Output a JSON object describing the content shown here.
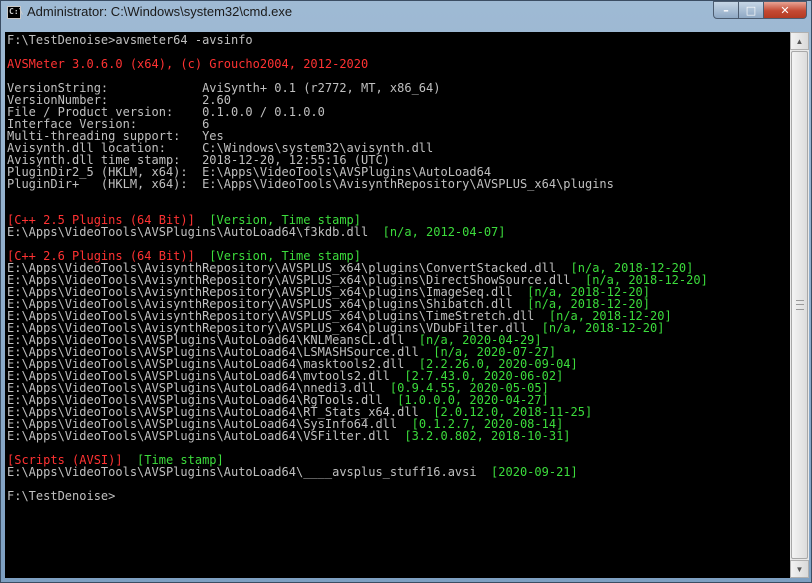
{
  "window": {
    "icon_label": "C:\\",
    "title": "Administrator: C:\\Windows\\system32\\cmd.exe",
    "minimize_glyph": "–",
    "maximize_glyph": "□",
    "close_glyph": "✕"
  },
  "colors": {
    "red": "#ff3232",
    "green": "#3cdc3c",
    "gray": "#c0c0c0",
    "console_bg": "#000000"
  },
  "console": {
    "lines": [
      [
        {
          "t": "F:\\TestDenoise>avsmeter64 -avsinfo",
          "c": "gray"
        }
      ],
      [],
      [
        {
          "t": "AVSMeter 3.0.6.0 (x64), (c) Groucho2004, 2012-2020",
          "c": "red"
        }
      ],
      [],
      [
        {
          "t": "VersionString:             AviSynth+ 0.1 (r2772, MT, x86_64)",
          "c": "gray"
        }
      ],
      [
        {
          "t": "VersionNumber:             2.60",
          "c": "gray"
        }
      ],
      [
        {
          "t": "File / Product version:    0.1.0.0 / 0.1.0.0",
          "c": "gray"
        }
      ],
      [
        {
          "t": "Interface Version:         6",
          "c": "gray"
        }
      ],
      [
        {
          "t": "Multi-threading support:   Yes",
          "c": "gray"
        }
      ],
      [
        {
          "t": "Avisynth.dll location:     C:\\Windows\\system32\\avisynth.dll",
          "c": "gray"
        }
      ],
      [
        {
          "t": "Avisynth.dll time stamp:   2018-12-20, 12:55:16 (UTC)",
          "c": "gray"
        }
      ],
      [
        {
          "t": "PluginDir2_5 (HKLM, x64):  E:\\Apps\\VideoTools\\AVSPlugins\\AutoLoad64",
          "c": "gray"
        }
      ],
      [
        {
          "t": "PluginDir+   (HKLM, x64):  E:\\Apps\\VideoTools\\AvisynthRepository\\AVSPLUS_x64\\plugins",
          "c": "gray"
        }
      ],
      [],
      [],
      [
        {
          "t": "[C++ 2.5 Plugins (64 Bit)]",
          "c": "red"
        },
        {
          "t": "  [Version, Time stamp]",
          "c": "green"
        }
      ],
      [
        {
          "t": "E:\\Apps\\VideoTools\\AVSPlugins\\AutoLoad64\\f3kdb.dll",
          "c": "gray"
        },
        {
          "t": "  [n/a, 2012-04-07]",
          "c": "green"
        }
      ],
      [],
      [
        {
          "t": "[C++ 2.6 Plugins (64 Bit)]",
          "c": "red"
        },
        {
          "t": "  [Version, Time stamp]",
          "c": "green"
        }
      ],
      [
        {
          "t": "E:\\Apps\\VideoTools\\AvisynthRepository\\AVSPLUS_x64\\plugins\\ConvertStacked.dll",
          "c": "gray"
        },
        {
          "t": "  [n/a, 2018-12-20]",
          "c": "green"
        }
      ],
      [
        {
          "t": "E:\\Apps\\VideoTools\\AvisynthRepository\\AVSPLUS_x64\\plugins\\DirectShowSource.dll",
          "c": "gray"
        },
        {
          "t": "  [n/a, 2018-12-20]",
          "c": "green"
        }
      ],
      [
        {
          "t": "E:\\Apps\\VideoTools\\AvisynthRepository\\AVSPLUS_x64\\plugins\\ImageSeq.dll",
          "c": "gray"
        },
        {
          "t": "  [n/a, 2018-12-20]",
          "c": "green"
        }
      ],
      [
        {
          "t": "E:\\Apps\\VideoTools\\AvisynthRepository\\AVSPLUS_x64\\plugins\\Shibatch.dll",
          "c": "gray"
        },
        {
          "t": "  [n/a, 2018-12-20]",
          "c": "green"
        }
      ],
      [
        {
          "t": "E:\\Apps\\VideoTools\\AvisynthRepository\\AVSPLUS_x64\\plugins\\TimeStretch.dll",
          "c": "gray"
        },
        {
          "t": "  [n/a, 2018-12-20]",
          "c": "green"
        }
      ],
      [
        {
          "t": "E:\\Apps\\VideoTools\\AvisynthRepository\\AVSPLUS_x64\\plugins\\VDubFilter.dll",
          "c": "gray"
        },
        {
          "t": "  [n/a, 2018-12-20]",
          "c": "green"
        }
      ],
      [
        {
          "t": "E:\\Apps\\VideoTools\\AVSPlugins\\AutoLoad64\\KNLMeansCL.dll",
          "c": "gray"
        },
        {
          "t": "  [n/a, 2020-04-29]",
          "c": "green"
        }
      ],
      [
        {
          "t": "E:\\Apps\\VideoTools\\AVSPlugins\\AutoLoad64\\LSMASHSource.dll",
          "c": "gray"
        },
        {
          "t": "  [n/a, 2020-07-27]",
          "c": "green"
        }
      ],
      [
        {
          "t": "E:\\Apps\\VideoTools\\AVSPlugins\\AutoLoad64\\masktools2.dll",
          "c": "gray"
        },
        {
          "t": "  [2.2.26.0, 2020-09-04]",
          "c": "green"
        }
      ],
      [
        {
          "t": "E:\\Apps\\VideoTools\\AVSPlugins\\AutoLoad64\\mvtools2.dll",
          "c": "gray"
        },
        {
          "t": "  [2.7.43.0, 2020-06-02]",
          "c": "green"
        }
      ],
      [
        {
          "t": "E:\\Apps\\VideoTools\\AVSPlugins\\AutoLoad64\\nnedi3.dll",
          "c": "gray"
        },
        {
          "t": "  [0.9.4.55, 2020-05-05]",
          "c": "green"
        }
      ],
      [
        {
          "t": "E:\\Apps\\VideoTools\\AVSPlugins\\AutoLoad64\\RgTools.dll",
          "c": "gray"
        },
        {
          "t": "  [1.0.0.0, 2020-04-27]",
          "c": "green"
        }
      ],
      [
        {
          "t": "E:\\Apps\\VideoTools\\AVSPlugins\\AutoLoad64\\RT_Stats_x64.dll",
          "c": "gray"
        },
        {
          "t": "  [2.0.12.0, 2018-11-25]",
          "c": "green"
        }
      ],
      [
        {
          "t": "E:\\Apps\\VideoTools\\AVSPlugins\\AutoLoad64\\SysInfo64.dll",
          "c": "gray"
        },
        {
          "t": "  [0.1.2.7, 2020-08-14]",
          "c": "green"
        }
      ],
      [
        {
          "t": "E:\\Apps\\VideoTools\\AVSPlugins\\AutoLoad64\\VSFilter.dll",
          "c": "gray"
        },
        {
          "t": "  [3.2.0.802, 2018-10-31]",
          "c": "green"
        }
      ],
      [],
      [
        {
          "t": "[Scripts (AVSI)]",
          "c": "red"
        },
        {
          "t": "  [Time stamp]",
          "c": "green"
        }
      ],
      [
        {
          "t": "E:\\Apps\\VideoTools\\AVSPlugins\\AutoLoad64\\____avsplus_stuff16.avsi",
          "c": "gray"
        },
        {
          "t": "  [2020-09-21]",
          "c": "green"
        }
      ],
      [],
      [
        {
          "t": "F:\\TestDenoise>",
          "c": "gray"
        }
      ]
    ]
  }
}
